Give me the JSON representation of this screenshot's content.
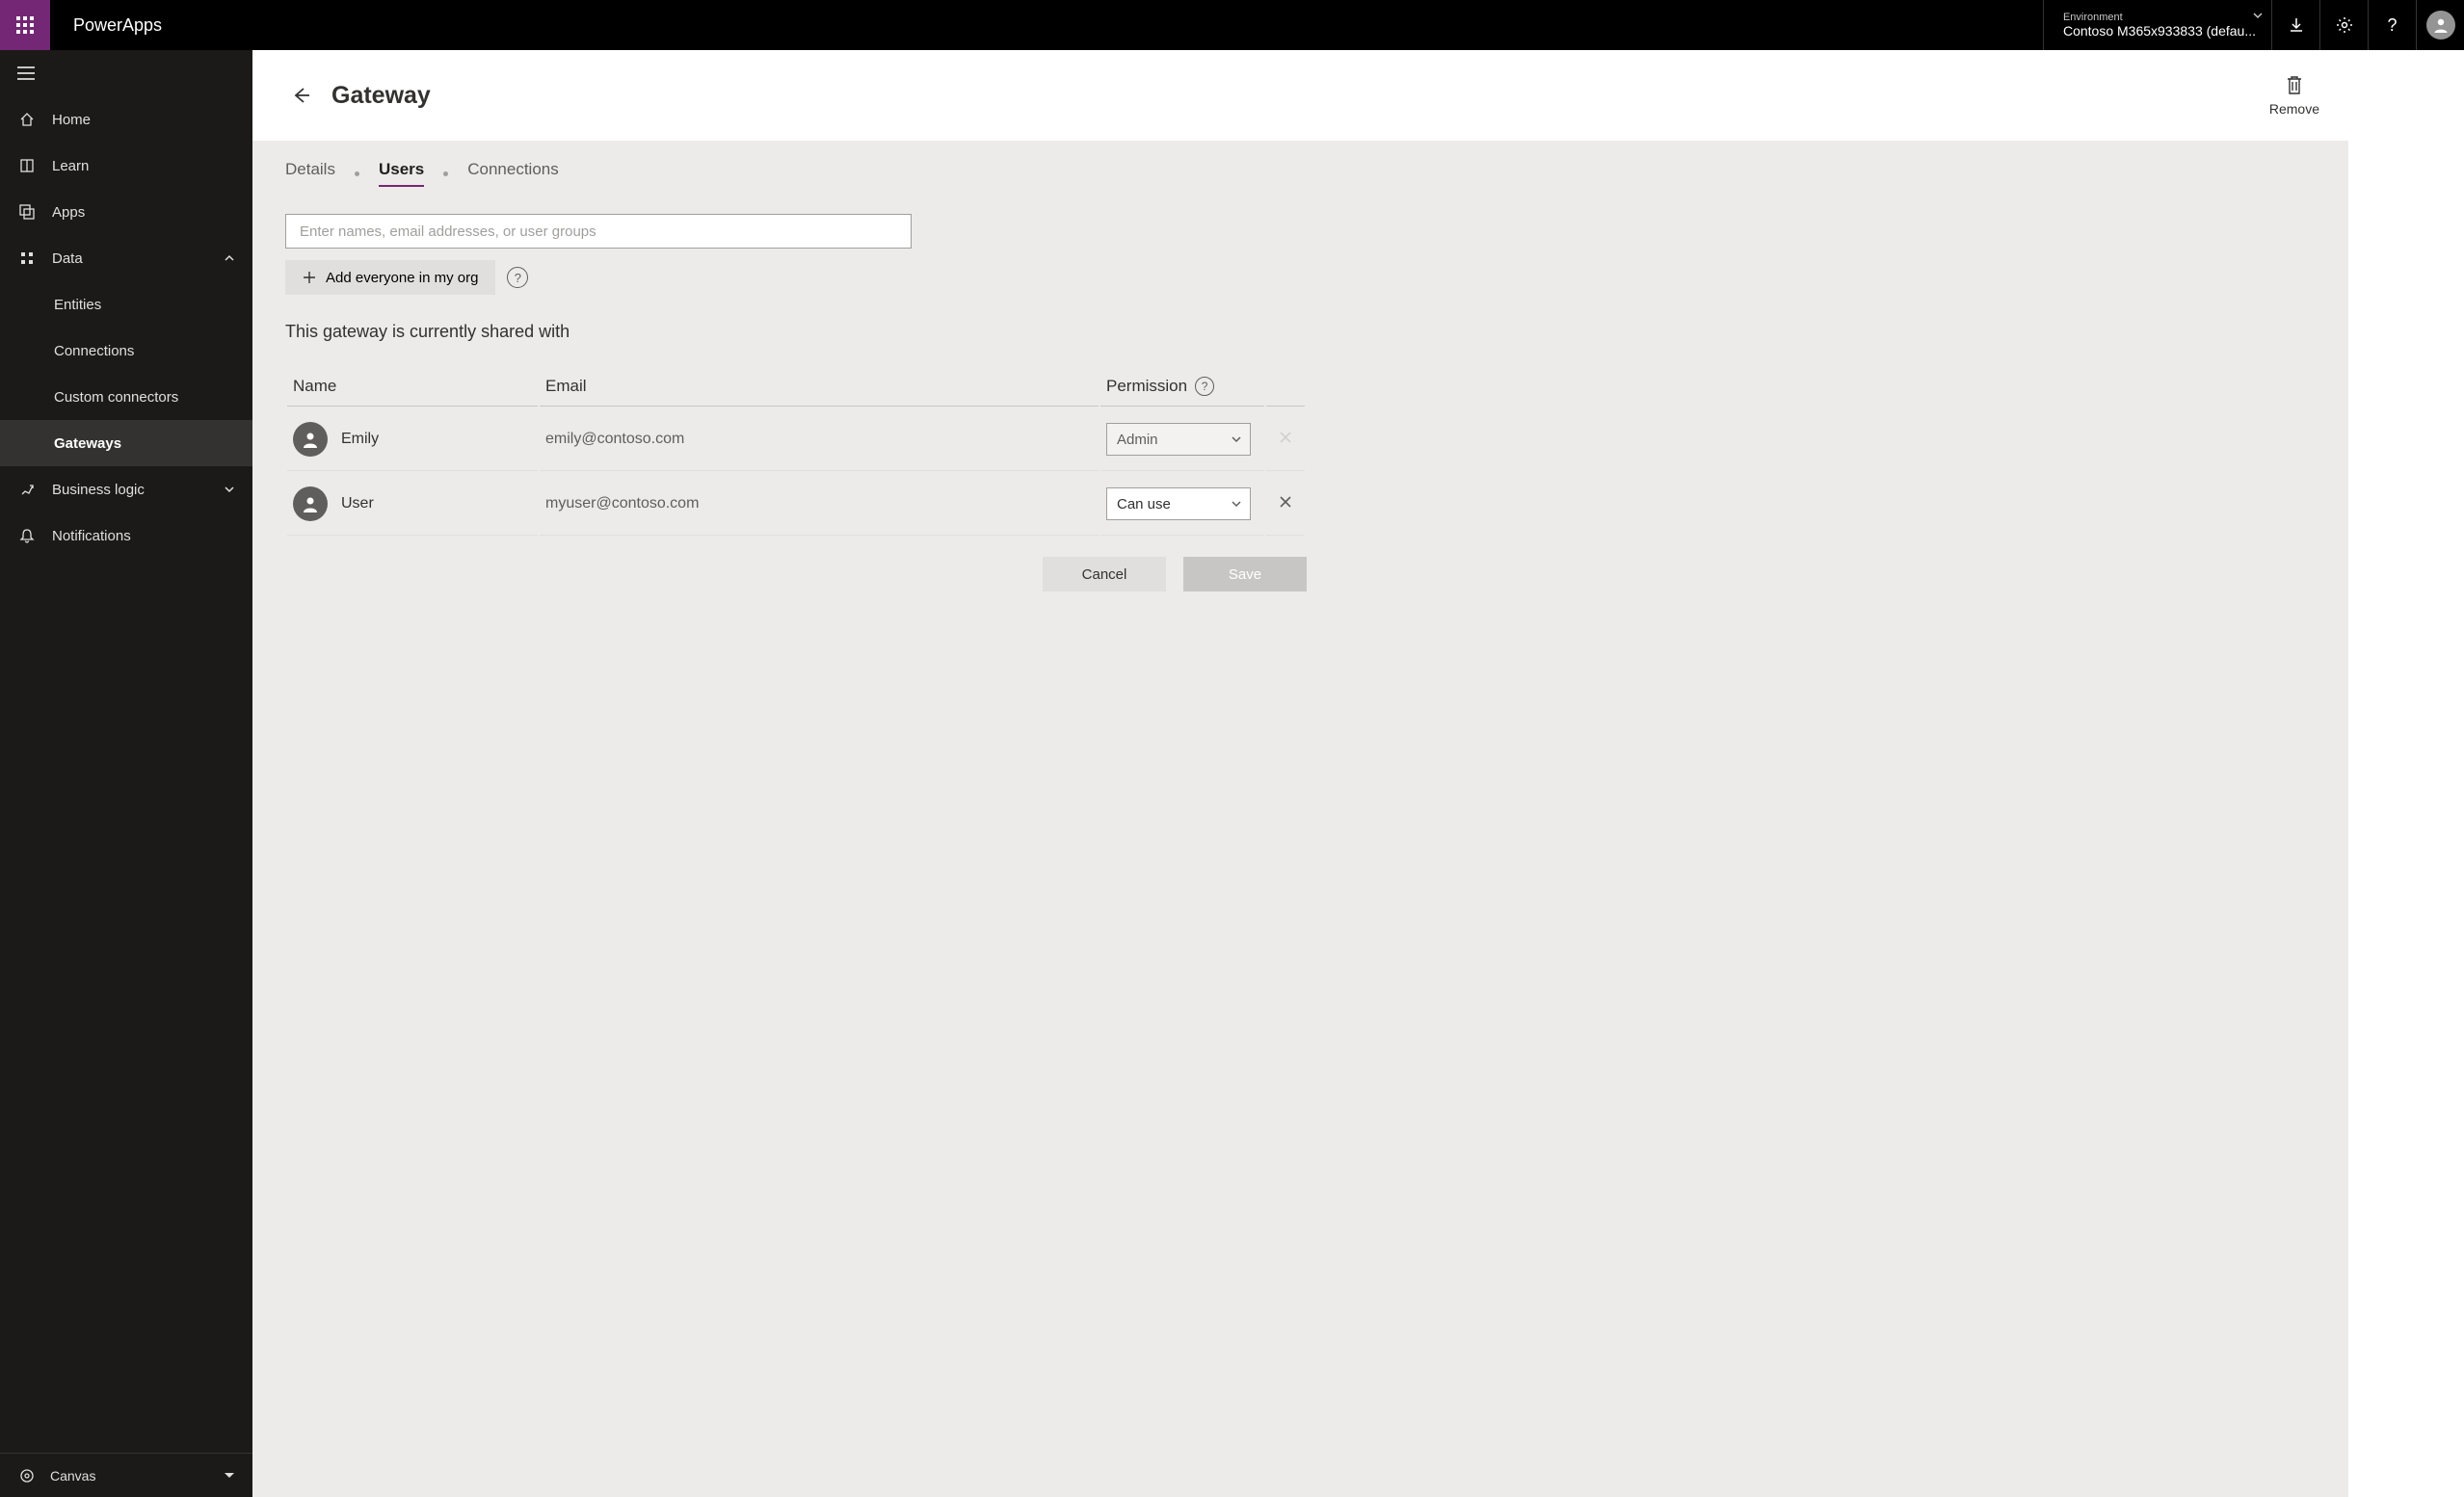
{
  "header": {
    "brand": "PowerApps",
    "environment_label": "Environment",
    "environment_name": "Contoso M365x933833 (defau..."
  },
  "sidebar": {
    "items": [
      {
        "label": "Home"
      },
      {
        "label": "Learn"
      },
      {
        "label": "Apps"
      },
      {
        "label": "Data",
        "expanded": true
      },
      {
        "label": "Business logic",
        "expanded": false
      },
      {
        "label": "Notifications"
      }
    ],
    "data_children": [
      {
        "label": "Entities"
      },
      {
        "label": "Connections"
      },
      {
        "label": "Custom connectors"
      },
      {
        "label": "Gateways",
        "active": true
      }
    ],
    "design_mode": "Canvas"
  },
  "page": {
    "title": "Gateway",
    "remove_label": "Remove",
    "tabs": {
      "details": "Details",
      "users": "Users",
      "connections": "Connections"
    },
    "search_placeholder": "Enter names, email addresses, or user groups",
    "add_everyone_label": "Add everyone in my org",
    "shared_with_heading": "This gateway is currently shared with",
    "columns": {
      "name": "Name",
      "email": "Email",
      "permission": "Permission"
    },
    "users": [
      {
        "name": "Emily",
        "email": "emily@contoso.com",
        "permission": "Admin",
        "perm_locked": true,
        "removable": false
      },
      {
        "name": "User",
        "email": "myuser@contoso.com",
        "permission": "Can use",
        "perm_locked": false,
        "removable": true
      }
    ],
    "buttons": {
      "cancel": "Cancel",
      "save": "Save"
    }
  }
}
